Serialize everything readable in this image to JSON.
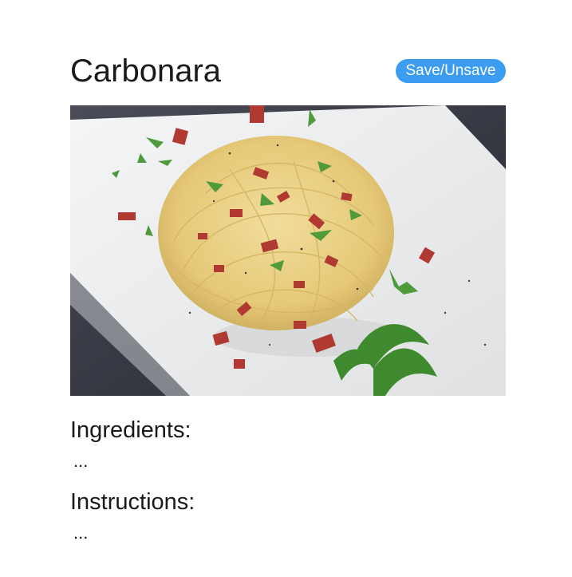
{
  "recipe": {
    "title": "Carbonara",
    "save_label": "Save/Unsave",
    "image_alt": "Spaghetti carbonara with bacon and parsley on a white plate",
    "ingredients_heading": "Ingredients:",
    "ingredients_text": "...",
    "instructions_heading": "Instructions:",
    "instructions_text": "..."
  },
  "colors": {
    "accent": "#3b9cf0",
    "text": "#1a1a1a",
    "background": "#ffffff"
  }
}
